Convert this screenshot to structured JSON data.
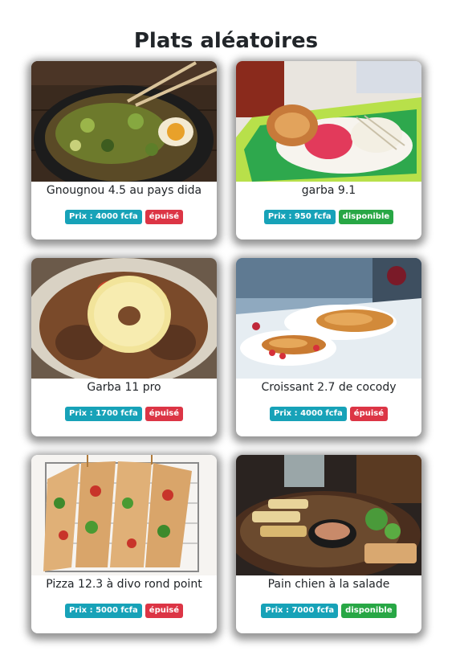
{
  "page": {
    "title": "Plats aléatoires"
  },
  "colors": {
    "price": "#17a2b8",
    "sold_out": "#dc3545",
    "available": "#28a745"
  },
  "cards": [
    {
      "name": "Gnougnou 4.5 au pays dida",
      "price": "Prix : 4000 fcfa",
      "status": "épuisé",
      "image": "noodle-bowl-photo"
    },
    {
      "name": "garba 9.1",
      "price": "Prix : 950 fcfa",
      "status": "disponible",
      "image": "fried-fish-salad-photo"
    },
    {
      "name": "Garba 11 pro",
      "price": "Prix : 1700 fcfa",
      "status": "épuisé",
      "image": "pineapple-ring-dish-photo"
    },
    {
      "name": "Croissant 2.7 de cocody",
      "price": "Prix : 4000 fcfa",
      "status": "épuisé",
      "image": "croissants-table-photo"
    },
    {
      "name": "Pizza 12.3 à divo rond point",
      "price": "Prix : 5000 fcfa",
      "status": "épuisé",
      "image": "flatbread-pizza-photo"
    },
    {
      "name": "Pain chien à la salade",
      "price": "Prix : 7000 fcfa",
      "status": "disponible",
      "image": "grilled-platter-photo"
    }
  ]
}
